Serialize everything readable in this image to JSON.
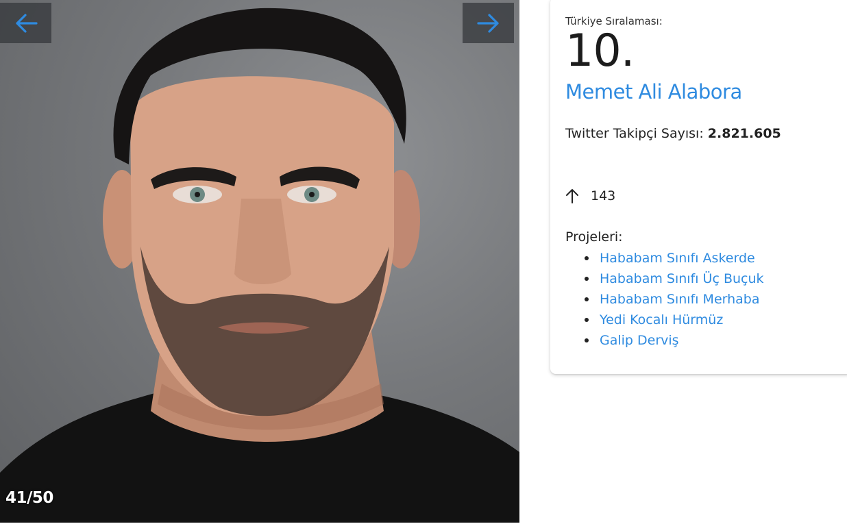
{
  "gallery": {
    "prev_icon": "arrow-left-icon",
    "next_icon": "arrow-right-icon",
    "counter": "41/50",
    "arrow_color": "#2f8be0"
  },
  "card": {
    "rank_label": "Türkiye Sıralaması:",
    "rank_value": "10.",
    "name": "Memet Ali Alabora",
    "followers_label": "Twitter Takipçi Sayısı:",
    "followers_value": "2.821.605",
    "trend_icon": "arrow-up-icon",
    "trend_value": "143",
    "projects_label": "Projeleri:",
    "projects": [
      "Hababam Sınıfı Askerde",
      "Hababam Sınıfı Üç Buçuk",
      "Hababam Sınıfı Merhaba",
      "Yedi Kocalı Hürmüz",
      "Galip Derviş"
    ],
    "link_color": "#2f8be0"
  }
}
